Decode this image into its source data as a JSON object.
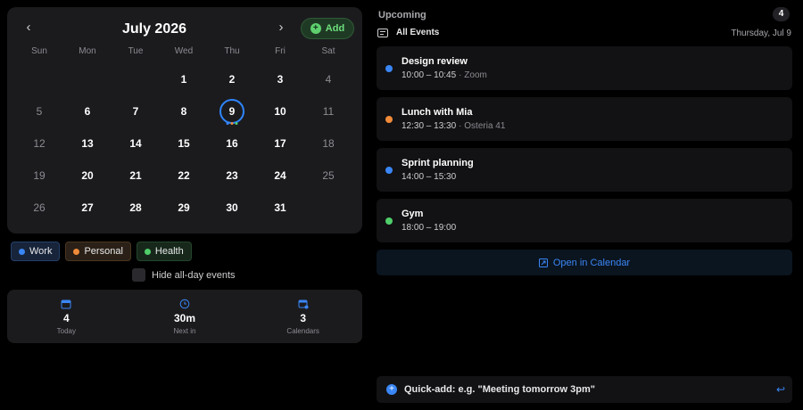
{
  "calendar": {
    "title": "July 2026",
    "add_label": "Add",
    "weekdays": [
      "Sun",
      "Mon",
      "Tue",
      "Wed",
      "Thu",
      "Fri",
      "Sat"
    ],
    "weeks": [
      [
        "",
        "",
        "",
        "1",
        "2",
        "3",
        "4"
      ],
      [
        "5",
        "6",
        "7",
        "8",
        "9",
        "10",
        "11"
      ],
      [
        "12",
        "13",
        "14",
        "15",
        "16",
        "17",
        "18"
      ],
      [
        "19",
        "20",
        "21",
        "22",
        "23",
        "24",
        "25"
      ],
      [
        "26",
        "27",
        "28",
        "29",
        "30",
        "31",
        ""
      ]
    ],
    "today": "9",
    "today_dots": [
      "#3a86f5",
      "#f08b3a",
      "#4fcf6a"
    ]
  },
  "legend": [
    {
      "label": "Work",
      "color": "#3a86f5",
      "cls": "work"
    },
    {
      "label": "Personal",
      "color": "#f08b3a",
      "cls": "personal"
    },
    {
      "label": "Health",
      "color": "#4fcf6a",
      "cls": "health"
    }
  ],
  "hide_allday_label": "Hide all-day events",
  "stats": [
    {
      "value": "4",
      "label": "Today",
      "icon": "calendar-icon"
    },
    {
      "value": "30m",
      "label": "Next in",
      "icon": "clock-icon"
    },
    {
      "value": "3",
      "label": "Calendars",
      "icon": "calendars-icon"
    }
  ],
  "upcoming": {
    "title": "Upcoming",
    "count": "4",
    "filter_label": "All Events",
    "date": "Thursday, Jul 9"
  },
  "events": [
    {
      "title": "Design review",
      "time": "10:00 – 10:45",
      "location": "· Zoom",
      "color": "#3a86f5"
    },
    {
      "title": "Lunch with Mia",
      "time": "12:30 – 13:30",
      "location": "· Osteria 41",
      "color": "#f08b3a"
    },
    {
      "title": "Sprint planning",
      "time": "14:00 – 15:30",
      "location": "",
      "color": "#3a86f5"
    },
    {
      "title": "Gym",
      "time": "18:00 – 19:00",
      "location": "",
      "color": "#4fcf6a"
    }
  ],
  "open_calendar_label": "Open in Calendar",
  "quick_add": {
    "placeholder": "Quick-add: e.g. \"Meeting tomorrow 3pm\""
  }
}
